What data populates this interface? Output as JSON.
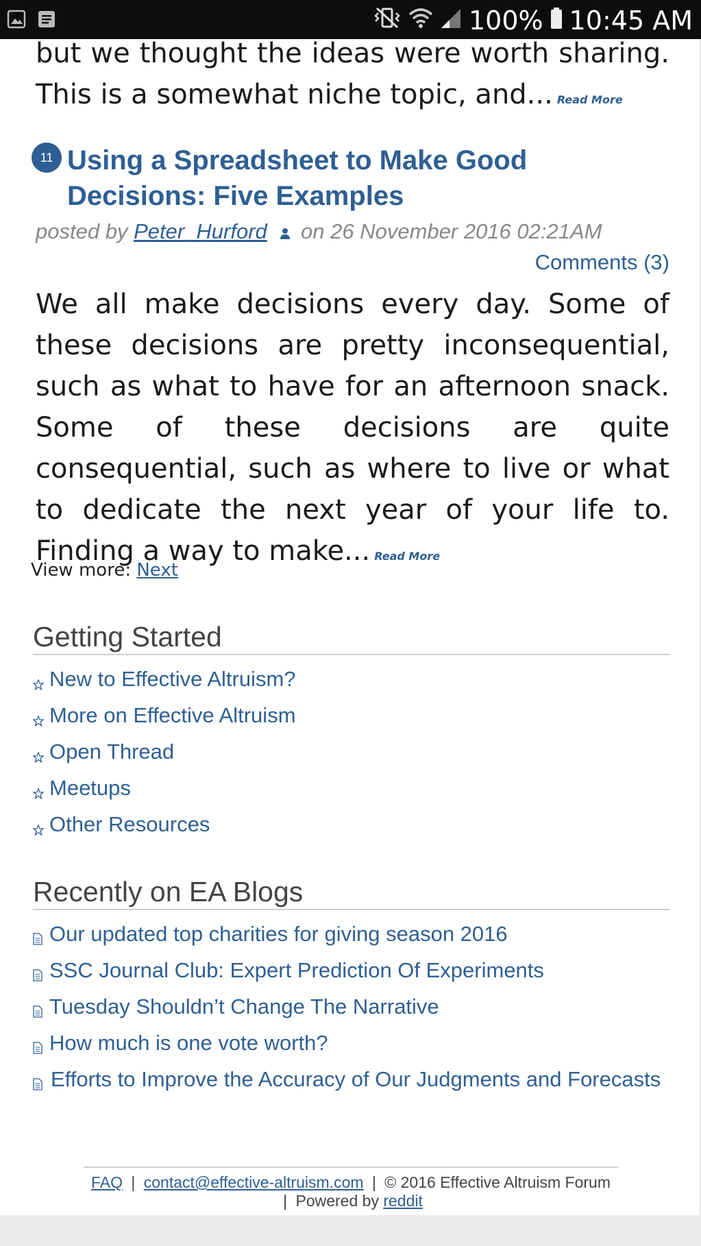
{
  "status_bar": {
    "battery": "100%",
    "time": "10:45 AM"
  },
  "prev_post": {
    "excerpt_line1": "but we thought the ideas were worth sharing.",
    "excerpt_line2": "This is a somewhat niche topic, and...",
    "read_more": "Read More"
  },
  "post": {
    "rank": "11",
    "title": "Using a Spreadsheet to Make Good Decisions: Five Examples",
    "posted_by": "posted by",
    "author": "Peter_Hurford",
    "date": "on 26 November 2016 02:21AM",
    "comments": "Comments (3)",
    "excerpt": "We all make decisions every day. Some of these decisions are pretty inconsequential, such as what to have for an afternoon snack. Some of these decisions are quite consequential, such as where to live or what to dedicate the next year of your life to. Finding a way to make...",
    "read_more": "Read More"
  },
  "pagination": {
    "label": "View more:",
    "next": "Next"
  },
  "getting_started": {
    "heading": "Getting Started",
    "items": [
      "New to Effective Altruism?",
      "More on Effective Altruism",
      "Open Thread",
      "Meetups",
      "Other Resources"
    ]
  },
  "recent_blogs": {
    "heading": "Recently on EA Blogs",
    "items": [
      "Our updated top charities for giving season 2016",
      "SSC Journal Club: Expert Prediction Of Experiments",
      "Tuesday Shouldn’t Change The Narrative",
      "How much is one vote worth?",
      "Efforts to Improve the Accuracy of Our Judgments and Forecasts"
    ]
  },
  "footer": {
    "faq": "FAQ",
    "sep": "|",
    "contact": "contact@effective-altruism.com",
    "copyright": "© 2016 Effective Altruism Forum",
    "powered_by": "Powered by",
    "reddit": "reddit"
  },
  "colors": {
    "link": "#2e5f94",
    "status_bar": "#0d0d0d",
    "heading": "#444444"
  }
}
